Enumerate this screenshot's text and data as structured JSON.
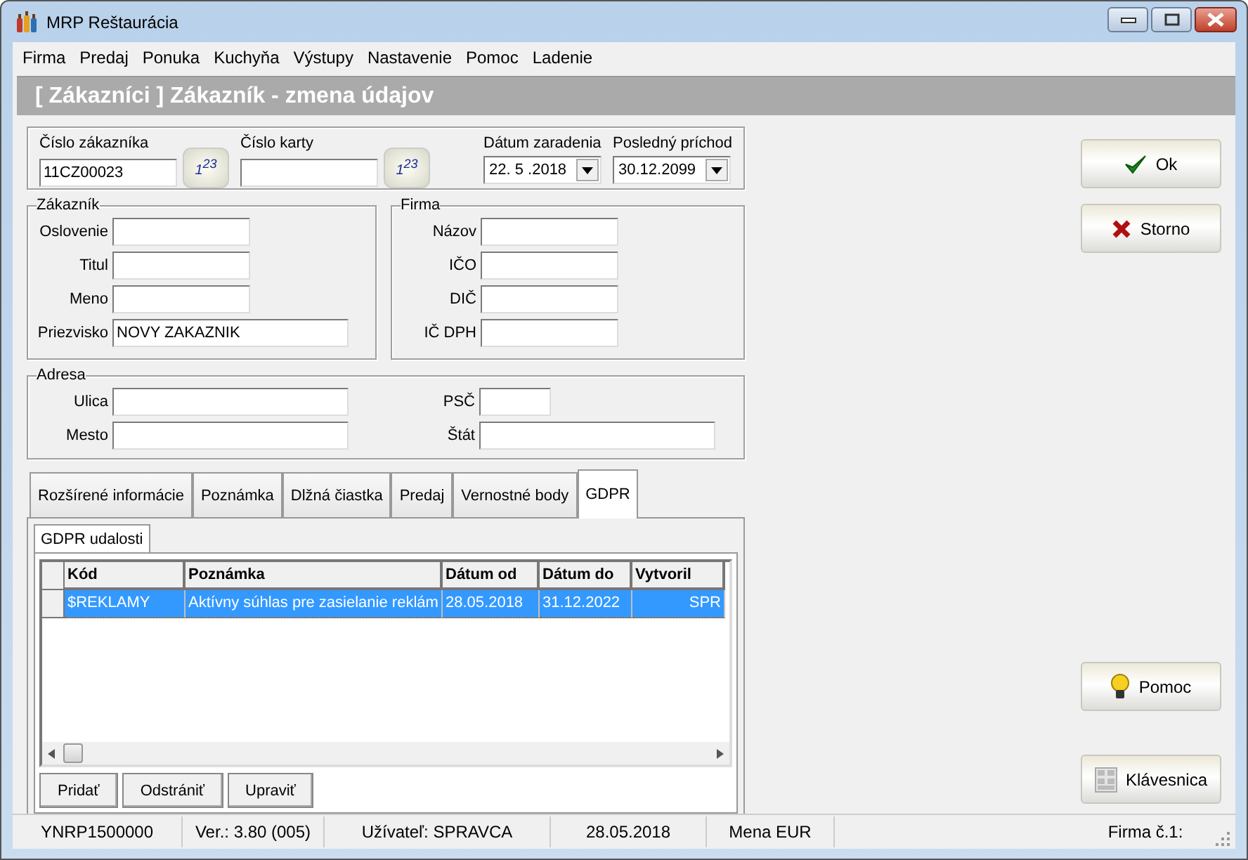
{
  "window": {
    "title": "MRP Reštaurácia"
  },
  "menu": [
    "Firma",
    "Predaj",
    "Ponuka",
    "Kuchyňa",
    "Výstupy",
    "Nastavenie",
    "Pomoc",
    "Ladenie"
  ],
  "header": "[ Zákazníci ] Zákazník - zmena údajov",
  "top_fields": [
    {
      "kind": "generated",
      "label": "Číslo zákazníka",
      "value": "11CZ00023",
      "button": "1$^{23}$"
    },
    {
      "kind": "generated",
      "label": "Číslo karty",
      "button": "1$^{23}$"
    },
    {
      "kind": "date",
      "label": "Dátum zaradenia",
      "value": "22. 5 .2018"
    },
    {
      "kind": "date",
      "label": "Posledný príchod",
      "value": "30.12.2099"
    }
  ],
  "customer": {
    "title": "Zákazník",
    "fields": [
      {
        "label": "Oslovenie"
      },
      {
        "label": "Titul"
      },
      {
        "label": "Meno"
      },
      {
        "label": "Priezvisko",
        "value": "NOVY ZAKAZNIK"
      }
    ]
  },
  "company": {
    "title": "Firma",
    "fields": [
      {
        "label": "Názov"
      },
      {
        "label": "IČO"
      },
      {
        "label": "DIČ"
      },
      {
        "label": "IČ DPH"
      }
    ]
  },
  "address": {
    "title": "Adresa",
    "left": [
      {
        "label": "Ulica"
      },
      {
        "label": "Mesto"
      }
    ],
    "right": [
      {
        "label": "PSČ"
      },
      {
        "label": "Štát"
      }
    ]
  },
  "tabs": [
    {
      "label": "Rozšírené informácie",
      "selected": false
    },
    {
      "label": "Poznámka",
      "selected": false
    },
    {
      "label": "Dlžná čiastka",
      "selected": false
    },
    {
      "label": "Predaj",
      "selected": false
    },
    {
      "label": "Vernostné body",
      "selected": false
    },
    {
      "label": "GDPR",
      "selected": true
    }
  ],
  "subtabs": [
    {
      "label": "GDPR udalosti",
      "selected": true
    }
  ],
  "table": {
    "columns": [
      "Kód",
      "Poznámka",
      "Dátum od",
      "Dátum do",
      "Vytvoril"
    ],
    "rows": [
      {
        "selected": true,
        "cells": [
          "$REKLAMY",
          "Aktívny súhlas pre zasielanie reklám",
          "28.05.2018",
          "31.12.2022",
          "SPR"
        ]
      }
    ]
  },
  "table_buttons": [
    "Pridať",
    "Odstrániť",
    "Upraviť"
  ],
  "side_buttons": [
    {
      "kind": "ok",
      "label": "Ok"
    },
    {
      "kind": "cancel",
      "label": "Storno"
    },
    {
      "kind": "help",
      "label": "Pomoc"
    },
    {
      "kind": "keyboard",
      "label": "Klávesnica"
    }
  ],
  "status_bar": [
    "YNRP1500000",
    "Ver.: 3.80 (005)",
    "Užívateľ: SPRAVCA",
    "28.05.2018",
    "Mena EUR",
    "Firma č.1:"
  ]
}
